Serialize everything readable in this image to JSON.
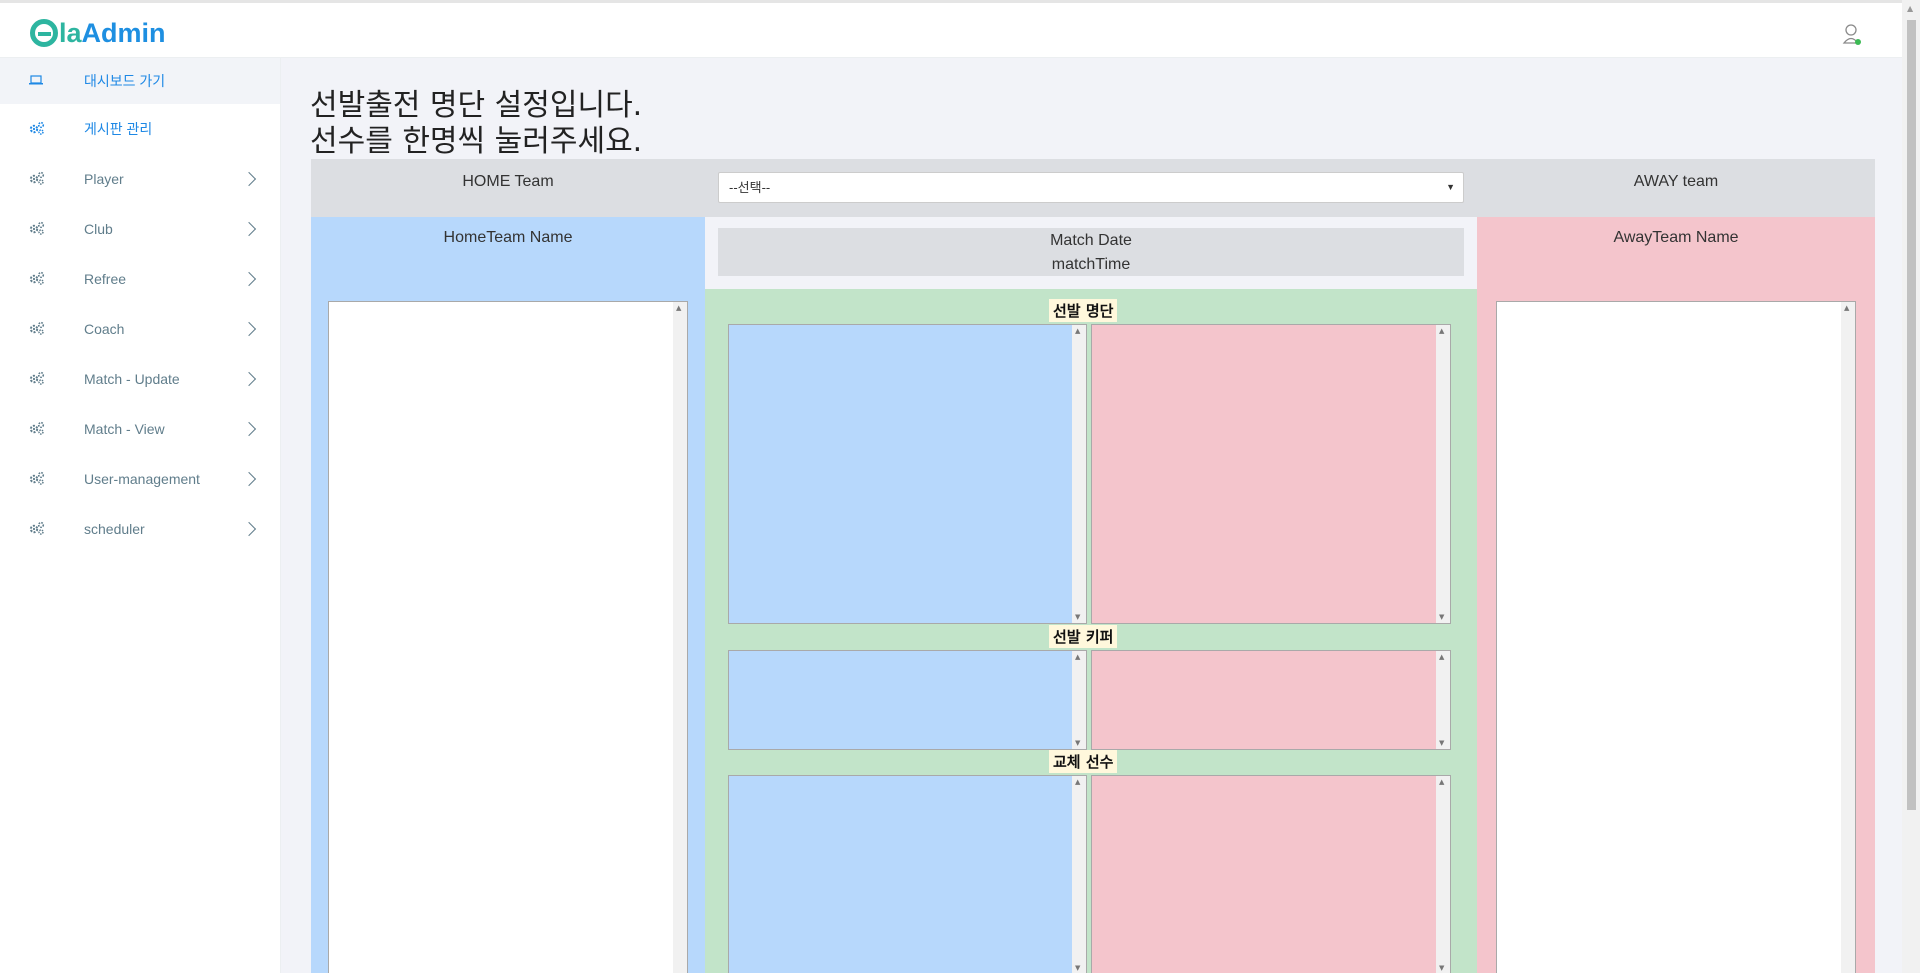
{
  "app": {
    "logo_letter": "e",
    "logo_la": "la",
    "logo_admin": "Admin"
  },
  "sidebar": {
    "items": [
      {
        "label": "대시보드 가기",
        "icon": "laptop-icon",
        "active": true
      },
      {
        "label": "게시판 관리",
        "icon": "gears-icon",
        "active": false
      },
      {
        "label": "Player",
        "icon": "gears-icon",
        "chevron": true
      },
      {
        "label": "Club",
        "icon": "gears-icon",
        "chevron": true
      },
      {
        "label": "Refree",
        "icon": "gears-icon",
        "chevron": true
      },
      {
        "label": "Coach",
        "icon": "gears-icon",
        "chevron": true
      },
      {
        "label": "Match - Update",
        "icon": "gears-icon",
        "chevron": true
      },
      {
        "label": "Match - View",
        "icon": "gears-icon",
        "chevron": true
      },
      {
        "label": "User-management",
        "icon": "gears-icon",
        "chevron": true
      },
      {
        "label": "scheduler",
        "icon": "gears-icon",
        "chevron": true
      }
    ]
  },
  "main": {
    "heading_line1": "선발출전 명단 설정입니다.",
    "heading_line2": "선수를 한명씩 눌러주세요.",
    "home_team_label": "HOME Team",
    "away_team_label": "AWAY team",
    "match_select": {
      "value": "--선택--"
    },
    "home_team_name": "HomeTeam Name",
    "away_team_name": "AwayTeam Name",
    "match_date": "Match Date",
    "match_time": "matchTime",
    "sections": {
      "starting": "선발 명단",
      "keeper": "선발 키퍼",
      "subs": "교체 선수"
    }
  },
  "colors": {
    "brand": "#2db5a0",
    "home": "#b7d8fc",
    "away": "#f4c5cc",
    "center": "#c2e4c9",
    "nav_active": "#1e88e5"
  }
}
